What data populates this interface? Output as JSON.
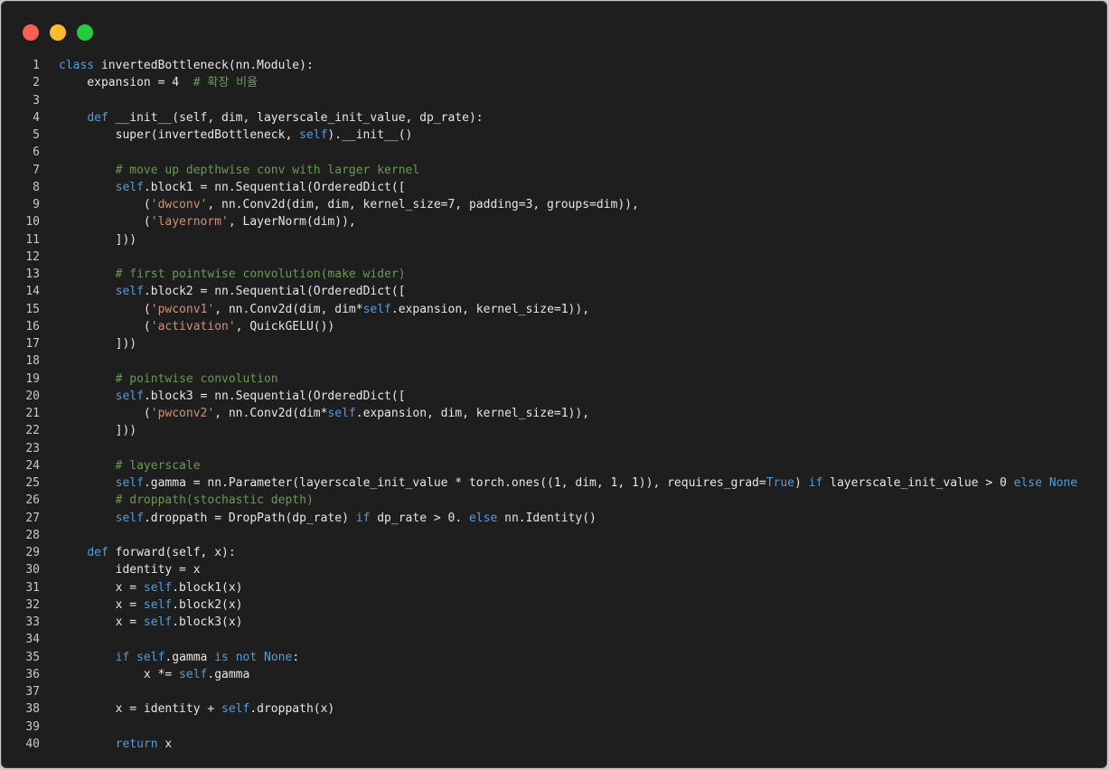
{
  "window": {
    "controls": [
      "close",
      "minimize",
      "zoom"
    ],
    "colors": {
      "close": "#ff5f56",
      "minimize": "#ffbd2e",
      "zoom": "#27c93f",
      "background": "#1e1e1e",
      "keyword": "#569cd6",
      "comment": "#6a9955",
      "string": "#ce9178",
      "text": "#e6e6e6"
    }
  },
  "editor": {
    "language": "python",
    "lines": [
      [
        [
          "kw",
          "class"
        ],
        [
          "df",
          " invertedBottleneck(nn.Module):"
        ]
      ],
      [
        [
          "df",
          "    expansion = 4  "
        ],
        [
          "cm",
          "# 확장 비율"
        ]
      ],
      [],
      [
        [
          "df",
          "    "
        ],
        [
          "kw",
          "def"
        ],
        [
          "df",
          " __init__(self, dim, layerscale_init_value, dp_rate):"
        ]
      ],
      [
        [
          "df",
          "        super(invertedBottleneck, "
        ],
        [
          "kw",
          "self"
        ],
        [
          "df",
          ").__init__()"
        ]
      ],
      [],
      [
        [
          "df",
          "        "
        ],
        [
          "cm",
          "# move up depthwise conv with larger kernel"
        ]
      ],
      [
        [
          "df",
          "        "
        ],
        [
          "kw",
          "self"
        ],
        [
          "df",
          ".block1 = nn.Sequential(OrderedDict(["
        ]
      ],
      [
        [
          "df",
          "            ("
        ],
        [
          "st",
          "'dwconv'"
        ],
        [
          "df",
          ", nn.Conv2d(dim, dim, kernel_size=7, padding=3, groups=dim)),"
        ]
      ],
      [
        [
          "df",
          "            ("
        ],
        [
          "st",
          "'layernorm'"
        ],
        [
          "df",
          ", LayerNorm(dim)),"
        ]
      ],
      [
        [
          "df",
          "        ]))"
        ]
      ],
      [],
      [
        [
          "df",
          "        "
        ],
        [
          "cm",
          "# first pointwise convolution(make wider)"
        ]
      ],
      [
        [
          "df",
          "        "
        ],
        [
          "kw",
          "self"
        ],
        [
          "df",
          ".block2 = nn.Sequential(OrderedDict(["
        ]
      ],
      [
        [
          "df",
          "            ("
        ],
        [
          "st",
          "'pwconv1'"
        ],
        [
          "df",
          ", nn.Conv2d(dim, dim*"
        ],
        [
          "kw",
          "self"
        ],
        [
          "df",
          ".expansion, kernel_size=1)),"
        ]
      ],
      [
        [
          "df",
          "            ("
        ],
        [
          "st",
          "'activation'"
        ],
        [
          "df",
          ", QuickGELU())"
        ]
      ],
      [
        [
          "df",
          "        ]))"
        ]
      ],
      [],
      [
        [
          "df",
          "        "
        ],
        [
          "cm",
          "# pointwise convolution"
        ]
      ],
      [
        [
          "df",
          "        "
        ],
        [
          "kw",
          "self"
        ],
        [
          "df",
          ".block3 = nn.Sequential(OrderedDict(["
        ]
      ],
      [
        [
          "df",
          "            ("
        ],
        [
          "st",
          "'pwconv2'"
        ],
        [
          "df",
          ", nn.Conv2d(dim*"
        ],
        [
          "kw",
          "self"
        ],
        [
          "df",
          ".expansion, dim, kernel_size=1)),"
        ]
      ],
      [
        [
          "df",
          "        ]))"
        ]
      ],
      [],
      [
        [
          "df",
          "        "
        ],
        [
          "cm",
          "# layerscale"
        ]
      ],
      [
        [
          "df",
          "        "
        ],
        [
          "kw",
          "self"
        ],
        [
          "df",
          ".gamma = nn.Parameter(layerscale_init_value * torch.ones((1, dim, 1, 1)), requires_grad="
        ],
        [
          "kw",
          "True"
        ],
        [
          "df",
          ") "
        ],
        [
          "kw",
          "if"
        ],
        [
          "df",
          " layerscale_init_value > 0 "
        ],
        [
          "kw",
          "else"
        ],
        [
          "df",
          " "
        ],
        [
          "kw",
          "None"
        ]
      ],
      [
        [
          "df",
          "        "
        ],
        [
          "cm",
          "# droppath(stochastic depth)"
        ]
      ],
      [
        [
          "df",
          "        "
        ],
        [
          "kw",
          "self"
        ],
        [
          "df",
          ".droppath = DropPath(dp_rate) "
        ],
        [
          "kw",
          "if"
        ],
        [
          "df",
          " dp_rate > 0. "
        ],
        [
          "kw",
          "else"
        ],
        [
          "df",
          " nn.Identity()"
        ]
      ],
      [],
      [
        [
          "df",
          "    "
        ],
        [
          "kw",
          "def"
        ],
        [
          "df",
          " forward(self, x):"
        ]
      ],
      [
        [
          "df",
          "        identity = x"
        ]
      ],
      [
        [
          "df",
          "        x = "
        ],
        [
          "kw",
          "self"
        ],
        [
          "df",
          ".block1(x)"
        ]
      ],
      [
        [
          "df",
          "        x = "
        ],
        [
          "kw",
          "self"
        ],
        [
          "df",
          ".block2(x)"
        ]
      ],
      [
        [
          "df",
          "        x = "
        ],
        [
          "kw",
          "self"
        ],
        [
          "df",
          ".block3(x)"
        ]
      ],
      [],
      [
        [
          "df",
          "        "
        ],
        [
          "kw",
          "if"
        ],
        [
          "df",
          " "
        ],
        [
          "kw",
          "self"
        ],
        [
          "df",
          ".gamma "
        ],
        [
          "kw",
          "is"
        ],
        [
          "df",
          " "
        ],
        [
          "kw",
          "not"
        ],
        [
          "df",
          " "
        ],
        [
          "kw",
          "None"
        ],
        [
          "df",
          ":"
        ]
      ],
      [
        [
          "df",
          "            x *= "
        ],
        [
          "kw",
          "self"
        ],
        [
          "df",
          ".gamma"
        ]
      ],
      [],
      [
        [
          "df",
          "        x = identity + "
        ],
        [
          "kw",
          "self"
        ],
        [
          "df",
          ".droppath(x)"
        ]
      ],
      [],
      [
        [
          "df",
          "        "
        ],
        [
          "kw",
          "return"
        ],
        [
          "df",
          " x"
        ]
      ]
    ]
  }
}
